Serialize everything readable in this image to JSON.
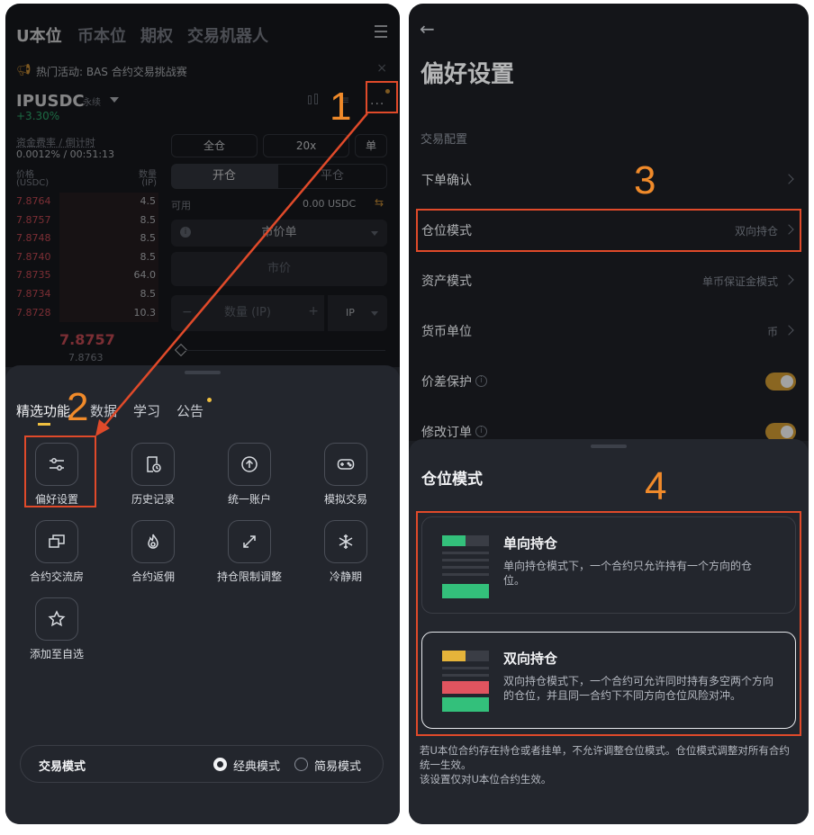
{
  "left": {
    "tabs": [
      "U本位",
      "币本位",
      "期权",
      "交易机器人"
    ],
    "banner": "热门活动: BAS 合约交易挑战赛",
    "symbol": "IPUSDC",
    "perp": "永续",
    "change": "+3.30%",
    "funding_label": "资金费率 / 倒计时",
    "funding_value": "0.0012% / 00:51:13",
    "price_header": "价格",
    "price_unit": "(USDC)",
    "qty_header": "数量",
    "qty_unit": "(IP)",
    "orderbook": [
      {
        "price": "7.8764",
        "qty": "4.5"
      },
      {
        "price": "7.8757",
        "qty": "8.5"
      },
      {
        "price": "7.8748",
        "qty": "8.5"
      },
      {
        "price": "7.8740",
        "qty": "8.5"
      },
      {
        "price": "7.8735",
        "qty": "64.0"
      },
      {
        "price": "7.8734",
        "qty": "8.5"
      },
      {
        "price": "7.8728",
        "qty": "10.3"
      }
    ],
    "last_price": "7.8757",
    "mark_price": "7.8763",
    "margin_mode": "全仓",
    "leverage": "20x",
    "single": "单",
    "open_tab": "开仓",
    "close_tab": "平仓",
    "available_label": "可用",
    "available_value": "0.00 USDC",
    "order_type": "市价单",
    "price_placeholder": "市价",
    "qty_placeholder": "数量 (IP)",
    "qty_unit_select": "IP",
    "sheet_tabs": [
      "精选功能",
      "数据",
      "学习",
      "公告"
    ],
    "features": [
      "偏好设置",
      "历史记录",
      "统一账户",
      "模拟交易",
      "合约交流房",
      "合约返佣",
      "持仓限制调整",
      "冷静期",
      "添加至自选"
    ],
    "trade_mode_label": "交易模式",
    "mode_classic": "经典模式",
    "mode_simple": "简易模式",
    "annotation_1": "1",
    "annotation_2": "2"
  },
  "right": {
    "title": "偏好设置",
    "section": "交易配置",
    "rows": [
      {
        "label": "下单确认",
        "value": ""
      },
      {
        "label": "仓位模式",
        "value": "双向持仓"
      },
      {
        "label": "资产模式",
        "value": "单币保证金模式"
      },
      {
        "label": "货币单位",
        "value": "币"
      },
      {
        "label": "价差保护",
        "value": ""
      },
      {
        "label": "修改订单",
        "value": ""
      }
    ],
    "sheet_title": "仓位模式",
    "one_way_title": "单向持仓",
    "one_way_desc": "单向持仓模式下，一个合约只允许持有一个方向的仓位。",
    "hedge_title": "双向持仓",
    "hedge_desc": "双向持仓模式下，一个合约可允许同时持有多空两个方向的仓位，并且同一合约下不同方向仓位风险对冲。",
    "note1": "若U本位合约存在持仓或者挂单，不允许调整仓位模式。仓位模式调整对所有合约统一生效。",
    "note2": "该设置仅对U本位合约生效。",
    "annotation_3": "3",
    "annotation_4": "4"
  },
  "colors": {
    "accent_orange": "#f08a2a",
    "annotation_red": "#e04a2a",
    "toggle": "#b8892c",
    "ask_red": "#e0545f",
    "bid_green": "#33c07b",
    "highlight_yellow": "#f0c040"
  }
}
